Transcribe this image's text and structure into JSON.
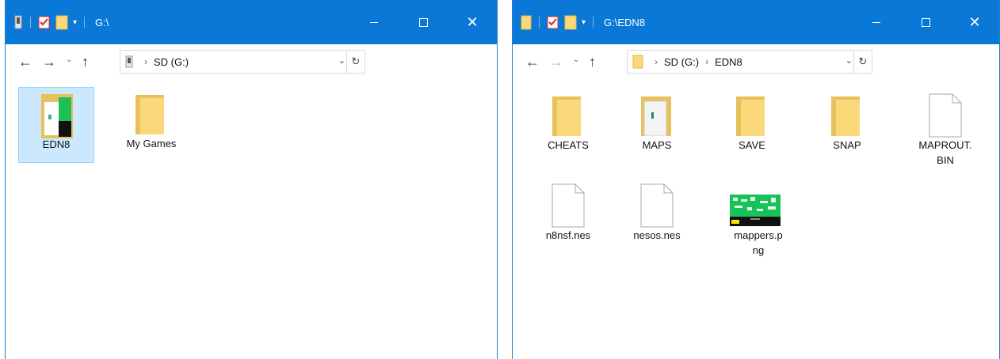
{
  "colors": {
    "titlebar": "#0a78d7",
    "selection": "#cce8ff",
    "folder": "#fbd87a"
  },
  "left_window": {
    "title": "G:\\",
    "address": {
      "crumbs": [
        "SD (G:)"
      ]
    },
    "items": [
      {
        "label": "EDN8",
        "icon": "folder-with-image-icon",
        "selected": true
      },
      {
        "label": "My Games",
        "icon": "folder-icon",
        "selected": false
      }
    ]
  },
  "right_window": {
    "title": "G:\\EDN8",
    "address": {
      "crumbs": [
        "SD (G:)",
        "EDN8"
      ]
    },
    "items": [
      {
        "label": "CHEATS",
        "icon": "folder-icon"
      },
      {
        "label": "MAPS",
        "icon": "folder-with-image-icon"
      },
      {
        "label": "SAVE",
        "icon": "folder-icon"
      },
      {
        "label": "SNAP",
        "icon": "folder-icon"
      },
      {
        "label": "MAPROUT.BIN",
        "label_line1": "MAPROUT.",
        "label_line2": "BIN",
        "icon": "blank-file-icon"
      },
      {
        "label": "n8nsf.nes",
        "icon": "blank-file-icon"
      },
      {
        "label": "nesos.nes",
        "icon": "blank-file-icon"
      },
      {
        "label": "mappers.png",
        "label_line1": "mappers.p",
        "label_line2": "ng",
        "icon": "image-thumbnail-icon"
      }
    ]
  }
}
